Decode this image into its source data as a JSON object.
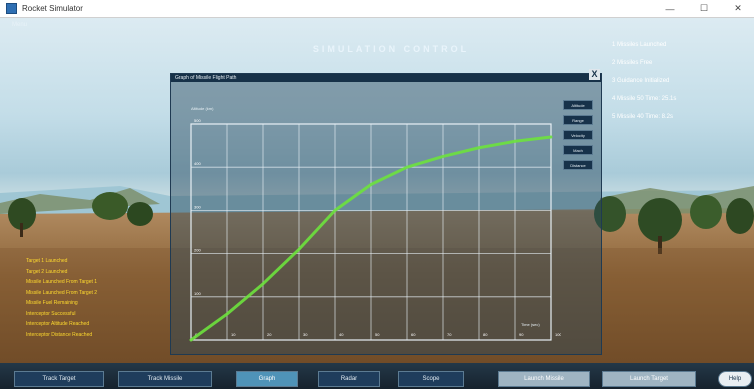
{
  "window": {
    "title": "Rocket Simulator",
    "minimize": "—",
    "maximize": "☐",
    "close": "✕"
  },
  "hud": {
    "top_left": "Menu",
    "title": "SIMULATION CONTROL"
  },
  "status_right": [
    "1 Missiles Launched",
    "2 Missiles Free",
    "3 Guidance Initialized",
    "4 Missile 50 Time: 25.1s",
    "5 Missile 40 Time: 8.2s"
  ],
  "log_left": [
    "Target 1 Launched",
    "Target 2 Launched",
    "Missile Launched From Target 1",
    "Missile Launched From Target 2",
    "Missile Fuel Remaining",
    "Interceptor Successful",
    "Interceptor Altitude Reached",
    "Interceptor Distance Reached"
  ],
  "graph": {
    "title": "Graph of Missile Flight Path",
    "close_label": "X",
    "buttons": [
      "Altitude",
      "Range",
      "Velocity",
      "Mach",
      "Distance"
    ],
    "chart_data": {
      "type": "line",
      "title": "",
      "ylabel": "Altitude (km)",
      "xlabel": "Time (sec)",
      "x": [
        0,
        10,
        20,
        30,
        40,
        50,
        60,
        70,
        80,
        90,
        100
      ],
      "y_ticks": [
        "0",
        "100",
        "200",
        "300",
        "400",
        "500"
      ],
      "x_ticks": [
        "0",
        "10",
        "20",
        "30",
        "40",
        "50",
        "60",
        "70",
        "80",
        "90",
        "100"
      ],
      "ylim": [
        0,
        500
      ],
      "xlim": [
        0,
        100
      ],
      "grid": true,
      "series": [
        {
          "name": "",
          "color": "#6de23d",
          "values": [
            0,
            60,
            130,
            210,
            300,
            360,
            400,
            425,
            445,
            460,
            470
          ]
        }
      ]
    }
  },
  "taskbar": {
    "buttons": [
      {
        "label": "Track Target",
        "state": "normal"
      },
      {
        "label": "Track Missile",
        "state": "normal"
      },
      {
        "label": "Graph",
        "state": "active"
      },
      {
        "label": "Radar",
        "state": "normal"
      },
      {
        "label": "Scope",
        "state": "normal"
      },
      {
        "label": "Launch Missile",
        "state": "light"
      },
      {
        "label": "Launch Target",
        "state": "light"
      },
      {
        "label": "Help",
        "state": "round"
      }
    ]
  }
}
